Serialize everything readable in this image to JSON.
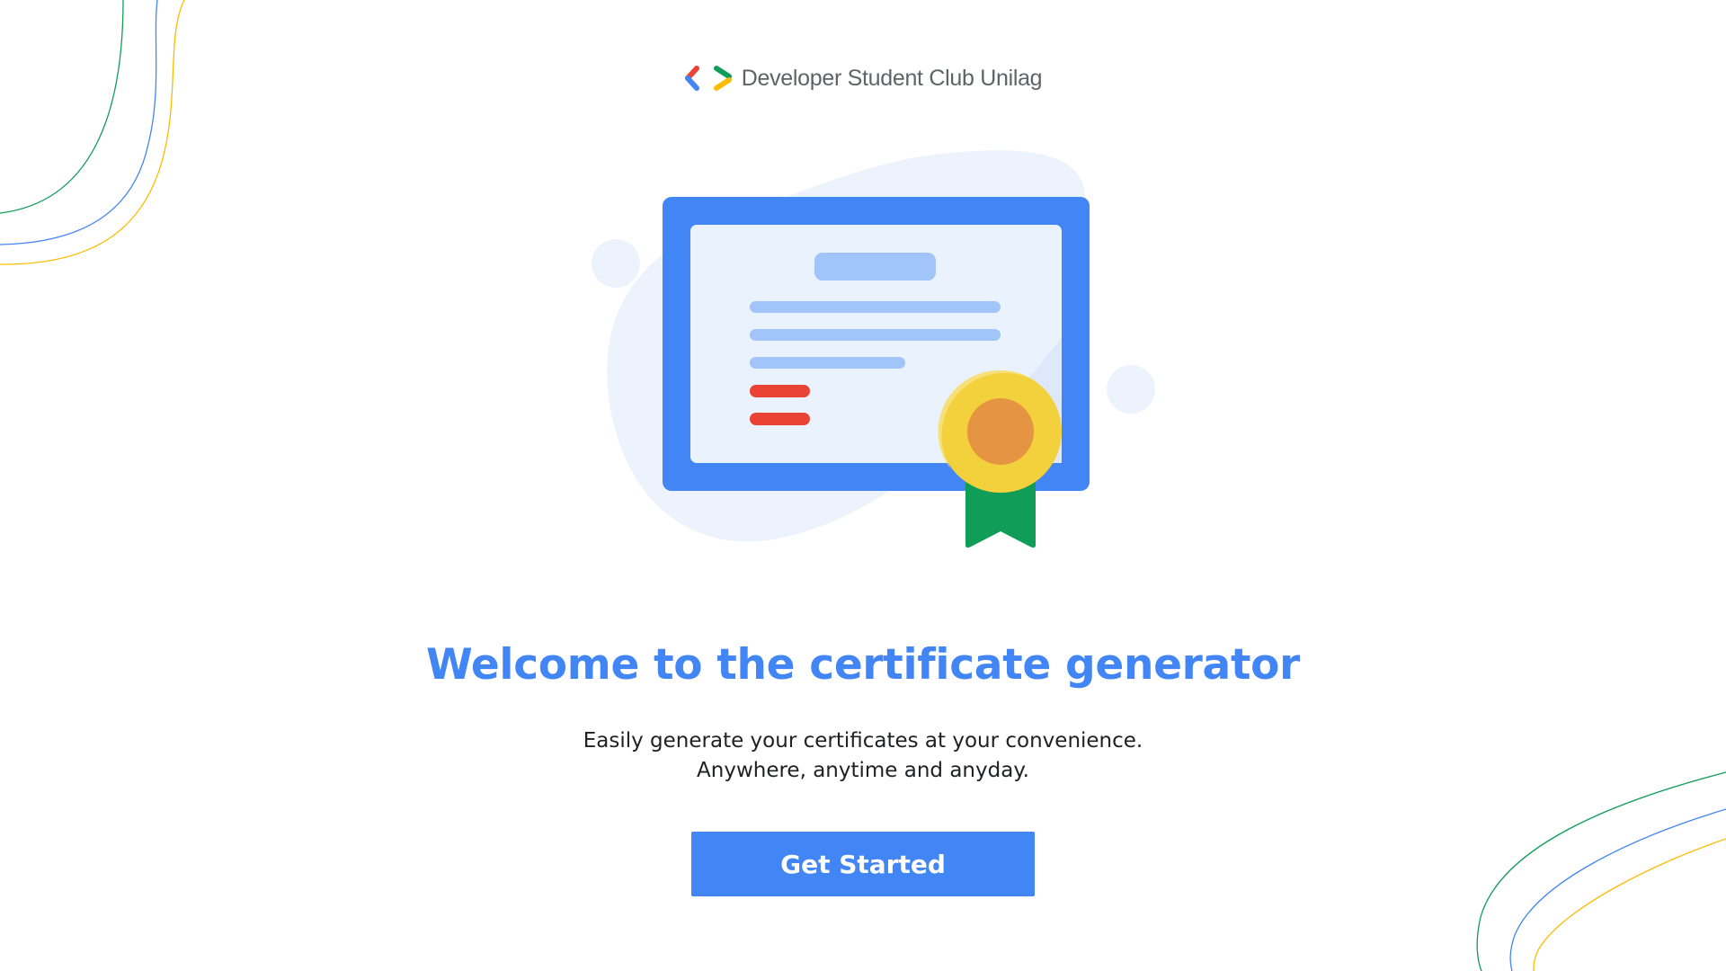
{
  "brand": {
    "logo_icon": "gdsc-brackets-icon",
    "name": "Developer Student Club Unilag"
  },
  "hero": {
    "illustration": "certificate-with-ribbon-icon"
  },
  "main": {
    "heading": "Welcome to the certificate generator",
    "description_line1": "Easily generate your certificates at your convenience.",
    "description_line2": "Anywhere, anytime and anyday."
  },
  "actions": {
    "get_started_label": "Get Started"
  },
  "colors": {
    "blue": "#4285f4",
    "red": "#ea4335",
    "yellow": "#fbbc04",
    "green": "#0f9d58",
    "text": "#202124",
    "muted": "#5f6368"
  }
}
